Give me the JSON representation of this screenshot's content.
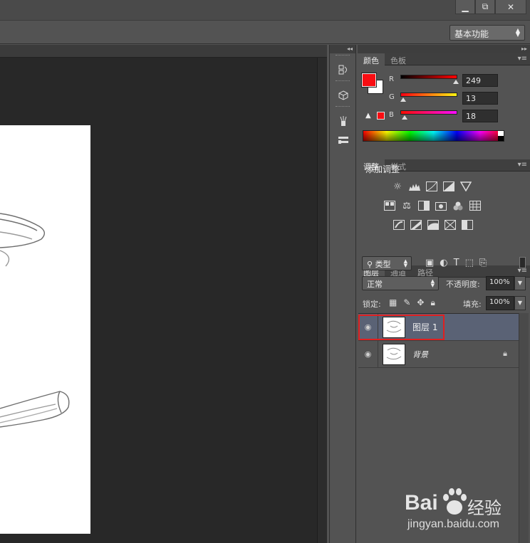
{
  "window": {
    "buttons": {
      "minimize": "▁",
      "restore": "⧉",
      "close": "✕"
    }
  },
  "optionsbar": {
    "workspace": "基本功能"
  },
  "color_panel": {
    "tabs": [
      "颜色",
      "色板"
    ],
    "channels": [
      {
        "label": "R",
        "value": "249"
      },
      {
        "label": "G",
        "value": "13"
      },
      {
        "label": "B",
        "value": "18"
      }
    ],
    "foreground": "#f90d12",
    "background": "#ffffff"
  },
  "adjust_panel": {
    "tabs": [
      "调整",
      "样式"
    ],
    "title": "添加调整"
  },
  "layers_panel": {
    "tabs": [
      "图层",
      "通道",
      "路径"
    ],
    "filter_kind": "类型",
    "blend_mode": "正常",
    "opacity_label": "不透明度:",
    "opacity_value": "100%",
    "lock_label": "锁定:",
    "fill_label": "填充:",
    "fill_value": "100%",
    "layers": [
      {
        "name": "图层 1",
        "selected": true
      },
      {
        "name": "背景",
        "locked": true
      }
    ],
    "highlight_color": "#e02020",
    "selected_row_color": "#5a6275"
  },
  "watermark": {
    "brand_left": "Bai",
    "brand_right": "经验",
    "url": "jingyan.baidu.com"
  }
}
